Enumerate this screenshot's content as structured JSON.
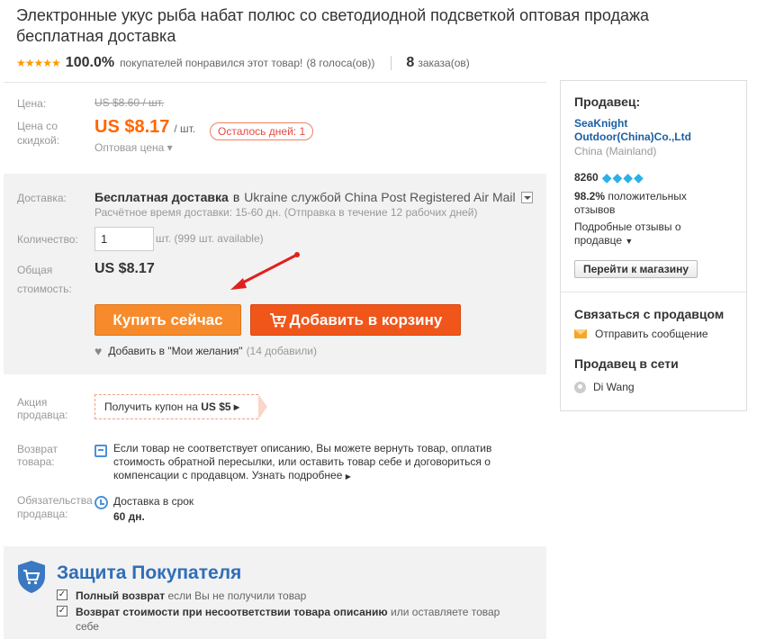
{
  "product": {
    "title": "Электронные укус рыба набат полюс со светодиодной подсветкой оптовая продажа бесплатная доставка",
    "stars": "★★★★★",
    "rating_pct": "100.0%",
    "rating_text": "покупателей понравился этот товар!",
    "rating_votes": "(8 голоса(ов))",
    "orders_count": "8",
    "orders_label": "заказа(ов)"
  },
  "price": {
    "label": "Цена:",
    "old": "US $8.60 / шт.",
    "discount_label": "Цена со скидкой:",
    "current": "US $8.17",
    "unit": "/ шт.",
    "days_left": "Осталось дней: 1",
    "wholesale": "Оптовая цена ▾"
  },
  "shipping": {
    "label": "Доставка:",
    "free": "Бесплатная доставка",
    "in_word": "в",
    "destination": "Ukraine службой China Post Registered Air Mail",
    "estimate": "Расчётное время доставки: 15-60 дн. (Отправка в течение 12 рабочих дней)"
  },
  "quantity": {
    "label": "Количество:",
    "value": "1",
    "available": "шт. (999 шт. available)"
  },
  "total": {
    "label": "Общая стоимость:",
    "value": "US $8.17"
  },
  "actions": {
    "buy_now": "Купить сейчас",
    "add_to_cart": "Добавить в корзину",
    "wishlist": "Добавить в \"Мои желания\"",
    "wishlist_count": "(14 добавили)"
  },
  "promo": {
    "label": "Акция продавца:",
    "coupon_text": "Получить купон на",
    "coupon_value": "US $5 ▸"
  },
  "returns": {
    "label": "Возврат товара:",
    "text": "Если товар не соответствует описанию, Вы можете вернуть товар, оплатив стоимость обратной пересылки, или оставить товар себе и договориться о компенсации с продавцом.",
    "more": "Узнать подробнее",
    "more_arrow": "▶"
  },
  "guarantee": {
    "label": "Обязательства продавца:",
    "line1": "Доставка в срок",
    "line2": "60 дн."
  },
  "protection": {
    "title": "Защита Покупателя",
    "item1_bold": "Полный возврат",
    "item1_rest": "если Вы не получили товар",
    "item2_bold": "Возврат стоимости при несоответствии товара описанию",
    "item2_rest": "или оставляете товар себе",
    "check": "✓"
  },
  "seller": {
    "heading": "Продавец:",
    "name": "SeaKnight Outdoor(China)Co.,Ltd",
    "country": "China (Mainland)",
    "score": "8260",
    "diamonds": "💎💎💎💎",
    "positive_pct": "98.2%",
    "positive_label": "положительных отзывов",
    "feedback_link": "Подробные отзывы о продавце",
    "feedback_caret": "▼",
    "store_button": "Перейти к магазину",
    "contact_heading": "Связаться с продавцом",
    "send_message": "Отправить сообщение",
    "online_heading": "Продавец в сети",
    "online_name": "Di Wang"
  },
  "colors": {
    "price": "#ff6600",
    "buy_button": "#f78b2c",
    "cart_button": "#f0561a",
    "protection_title": "#2f6eb8",
    "seller_link": "#1a5fa3",
    "arrow": "#e02020"
  }
}
